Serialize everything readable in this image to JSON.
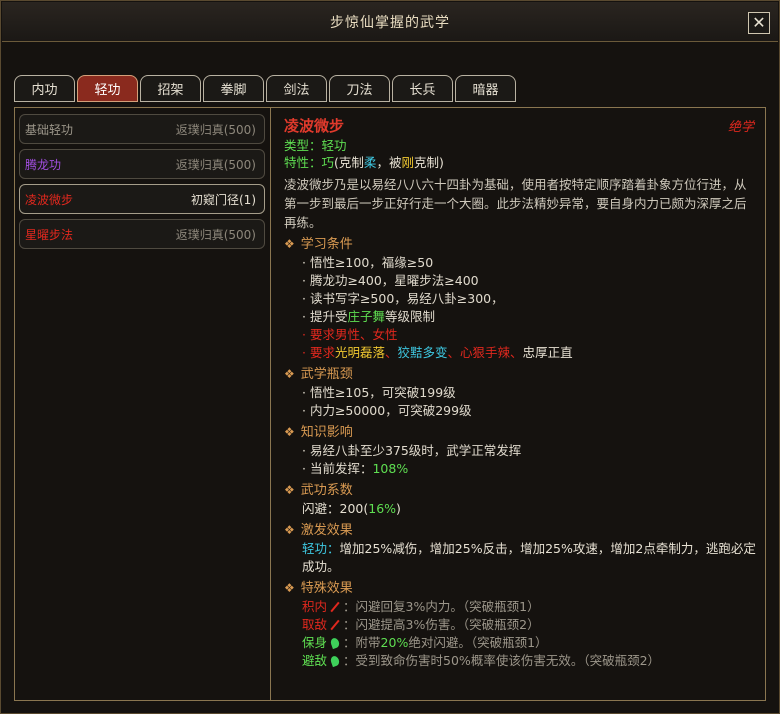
{
  "window": {
    "title": "步惊仙掌握的武学",
    "close_label": "✕"
  },
  "tabs": [
    "内功",
    "轻功",
    "招架",
    "拳脚",
    "剑法",
    "刀法",
    "长兵",
    "暗器"
  ],
  "active_tab": 1,
  "skills": [
    {
      "name": "基础轻功",
      "level": "返璞归真(500)",
      "color": "#9c968a"
    },
    {
      "name": "腾龙功",
      "level": "返璞归真(500)",
      "color": "#a24ee0"
    },
    {
      "name": "凌波微步",
      "level": "初窥门径(1)",
      "color": "#e0281e"
    },
    {
      "name": "星曜步法",
      "level": "返璞归真(500)",
      "color": "#e0281e"
    }
  ],
  "detail": {
    "name": "凌波微步",
    "rank": "绝学",
    "type_label": "类型：",
    "type_value": "轻功",
    "trait_label": "特性：",
    "trait_value": "巧",
    "trait_p1": "(克制",
    "trait_counter": "柔",
    "trait_p2": "，被",
    "trait_countered_by": "刚",
    "trait_p3": "克制)",
    "description": "凌波微步乃是以易经八八六十四卦为基础，使用者按特定顺序踏着卦象方位行进，从第一步到最后一步正好行走一个大圈。此步法精妙异常，要自身内力已颇为深厚之后再练。",
    "sections": {
      "learn": {
        "title": "学习条件",
        "items": [
          "悟性≥100，福缘≥50",
          "腾龙功≥400，星曜步法≥400",
          "读书写字≥500，易经八卦≥300，"
        ],
        "limit_pre": "提升受",
        "limit_skill": "庄子舞",
        "limit_post": "等级限制",
        "gender": "要求男性、女性",
        "req_pre": "要求",
        "req_a": "光明磊落",
        "req_b": "狡黠多变",
        "req_c": "心狠手辣",
        "req_d": "忠厚正直"
      },
      "bottleneck": {
        "title": "武学瓶颈",
        "items": [
          "悟性≥105，可突破199级",
          "内力≥50000，可突破299级"
        ]
      },
      "knowledge": {
        "title": "知识影响",
        "item1": "易经八卦至少375级时，武学正常发挥",
        "item2_label": "当前发挥：",
        "item2_value": "108%"
      },
      "coef": {
        "title": "武功系数",
        "label": "闪避：200(",
        "value": "16%",
        "close": ")"
      },
      "trigger": {
        "title": "激发效果",
        "label": "轻功：",
        "text": "增加25%减伤，增加25%反击，增加25%攻速，增加2点牵制力，逃跑必定成功。"
      },
      "special": {
        "title": "特殊效果",
        "effects": [
          {
            "name": "积内",
            "sep": "：",
            "text": "闪避回复3%内力。（突破瓶颈1）"
          },
          {
            "name": "取敌",
            "sep": "：",
            "text": "闪避提高3%伤害。（突破瓶颈2）"
          },
          {
            "name": "保身",
            "sep": "：",
            "pre": "附带",
            "value": "20%",
            "text": "绝对闪避。（突破瓶颈1）"
          },
          {
            "name": "避敌",
            "sep": "：",
            "text": "受到致命伤害时50%概率使该伤害无效。（突破瓶颈2）"
          }
        ]
      }
    }
  }
}
